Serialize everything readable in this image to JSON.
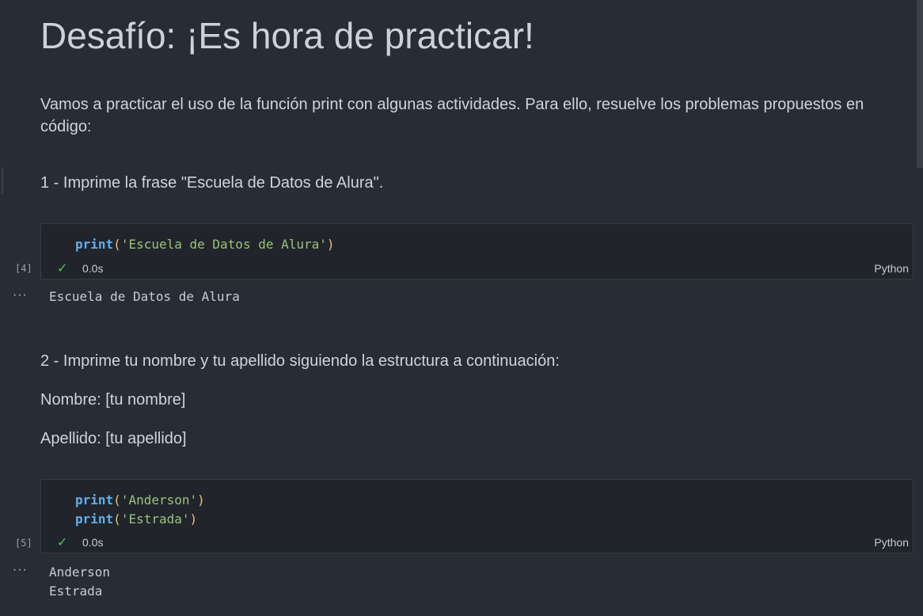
{
  "markdown": {
    "title": "Desafío: ¡Es hora de practicar!",
    "intro": "Vamos a practicar el uso de la función print con algunas actividades. Para ello, resuelve los problemas propuestos en código:",
    "q1": "1 - Imprime la frase \"Escuela de Datos de Alura\".",
    "q2": "2 - Imprime tu nombre y tu apellido siguiendo la estructura a continuación:",
    "nombre": "Nombre: [tu nombre]",
    "apellido": "Apellido: [tu apellido]"
  },
  "cells": [
    {
      "exec_count": "[4]",
      "lines": [
        {
          "fn": "print",
          "open": "(",
          "arg": "'Escuela de Datos de Alura'",
          "close": ")"
        }
      ],
      "status_time": "0.0s",
      "language": "Python",
      "output": [
        "Escuela de Datos de Alura"
      ]
    },
    {
      "exec_count": "[5]",
      "lines": [
        {
          "fn": "print",
          "open": "(",
          "arg": "'Anderson'",
          "close": ")"
        },
        {
          "fn": "print",
          "open": "(",
          "arg": "'Estrada'",
          "close": ")"
        }
      ],
      "status_time": "0.0s",
      "language": "Python",
      "output": [
        "Anderson",
        "Estrada"
      ]
    }
  ],
  "ui": {
    "output_menu": "···",
    "check_icon": "✓"
  },
  "colors": {
    "background": "#282c34",
    "cell_background": "#21252b",
    "keyword": "#61afef",
    "string": "#98c379",
    "paren": "#e5c07b",
    "success": "#4ec955"
  }
}
